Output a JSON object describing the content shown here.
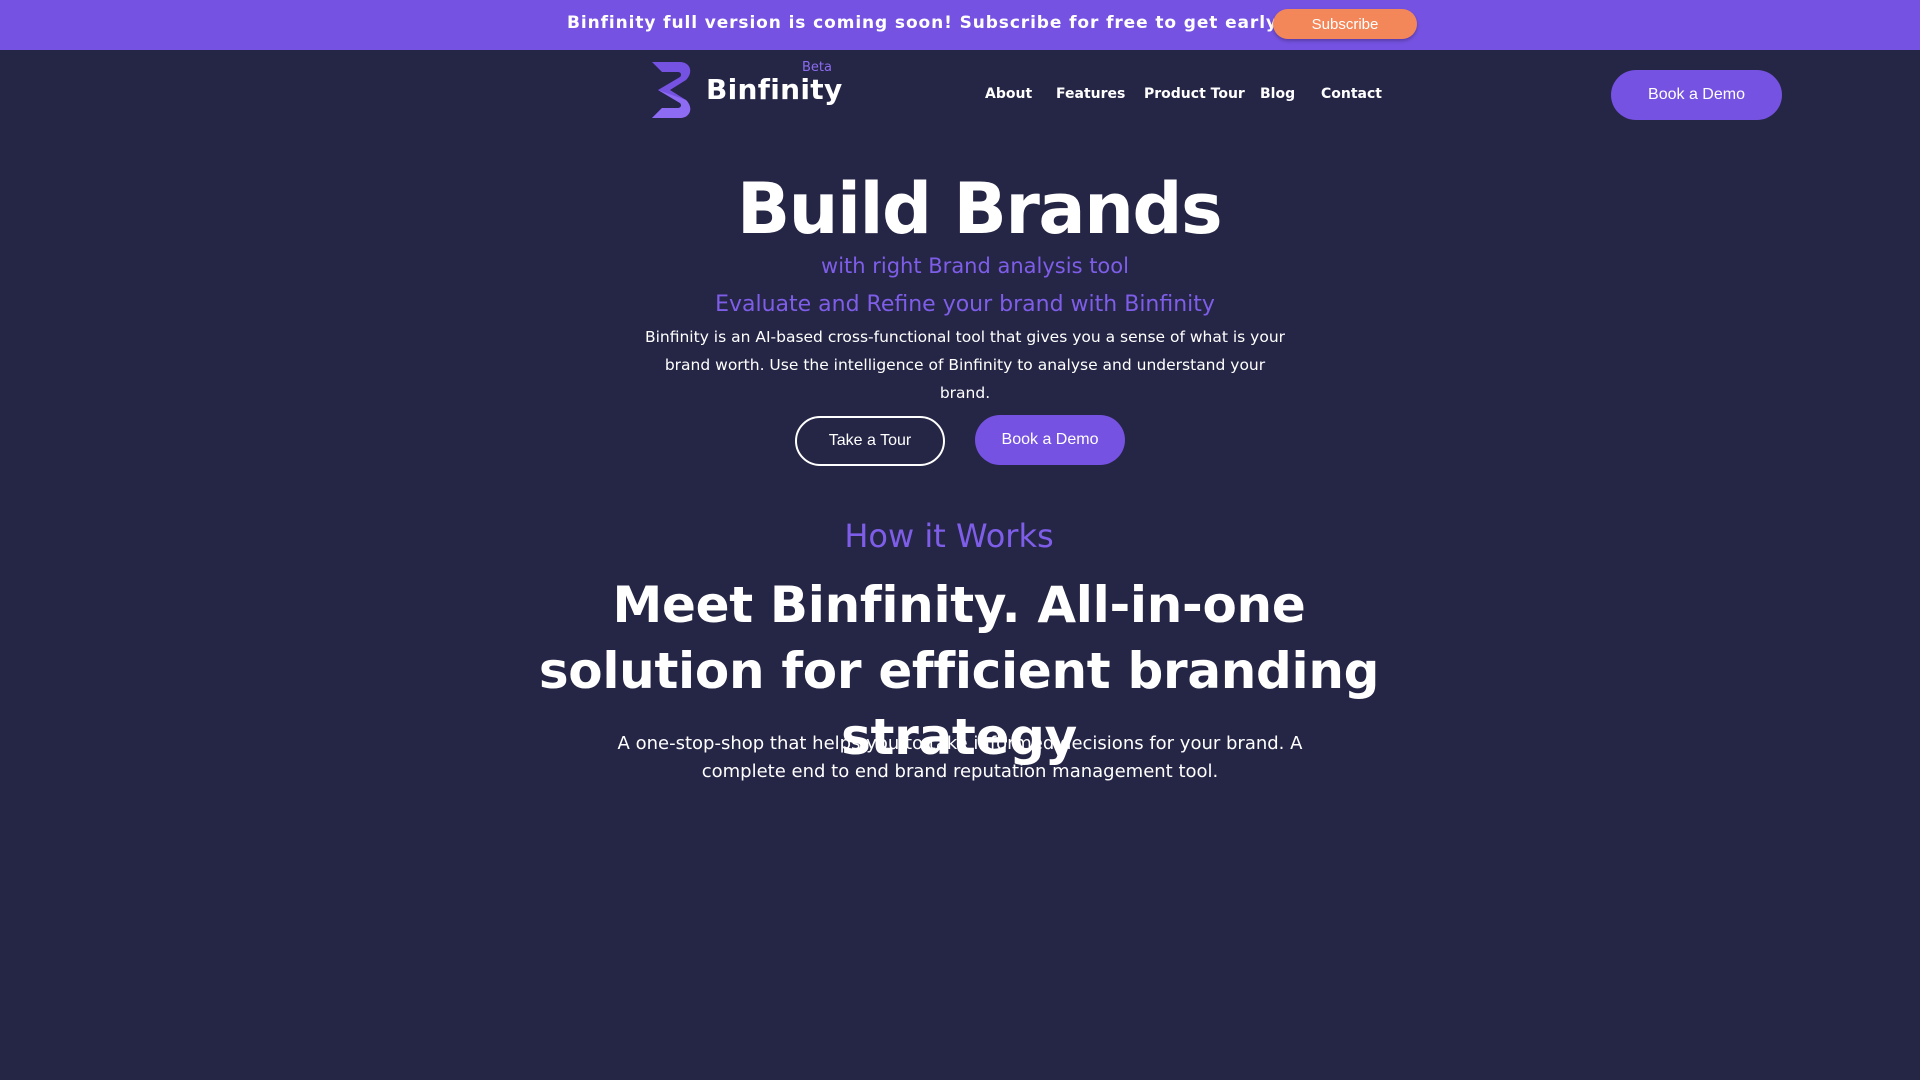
{
  "announcement": {
    "text": "Binfinity full version is coming soon! Subscribe for free to get early access!",
    "subscribe_label": "Subscribe"
  },
  "header": {
    "brand_name": "Binfinity",
    "beta_label": "Beta",
    "nav": [
      {
        "label": "About"
      },
      {
        "label": "Features"
      },
      {
        "label": "Product Tour"
      },
      {
        "label": "Blog"
      },
      {
        "label": "Contact"
      }
    ],
    "demo_label": "Book a Demo"
  },
  "hero": {
    "title": "Build Brands",
    "subtitle": "with right Brand analysis tool",
    "tagline": "Evaluate and Refine your brand with Binfinity",
    "description": "Binfinity is an AI-based cross-functional tool that gives you a sense of what is your brand worth. Use the intelligence of Binfinity to analyse and understand your brand.",
    "tour_label": "Take a Tour",
    "demo_label": "Book a Demo"
  },
  "how_it_works": {
    "label": "How it Works",
    "title": "Meet Binfinity. All-in-one solution for efficient branding strategy",
    "description": "A one-stop-shop that helps you to take informed decisions for your brand. A complete end to end brand reputation management tool."
  },
  "colors": {
    "background": "#252546",
    "accent": "#7552e1",
    "accent_text": "#7e5ee8",
    "subscribe": "#f4875a"
  }
}
